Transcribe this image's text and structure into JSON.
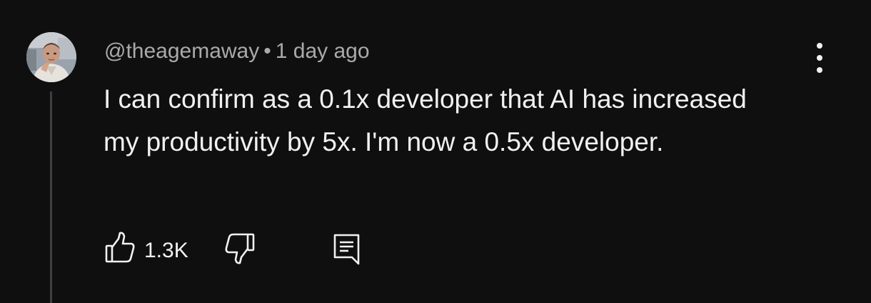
{
  "comment": {
    "author": "@theagemaway",
    "separator": "•",
    "time": "1 day ago",
    "text": "I can confirm as a 0.1x developer that AI has increased my productivity by 5x. I'm now a 0.5x developer.",
    "like_count": "1.3K"
  },
  "icons": {
    "like": "thumbs-up-icon",
    "dislike": "thumbs-down-icon",
    "reply": "reply-comment-icon",
    "menu": "more-vertical-icon"
  },
  "colors": {
    "background": "#0f0f0f",
    "text_primary": "#f1f1f1",
    "text_secondary": "#aaaaaa",
    "thread_line": "#3f3f3f"
  }
}
